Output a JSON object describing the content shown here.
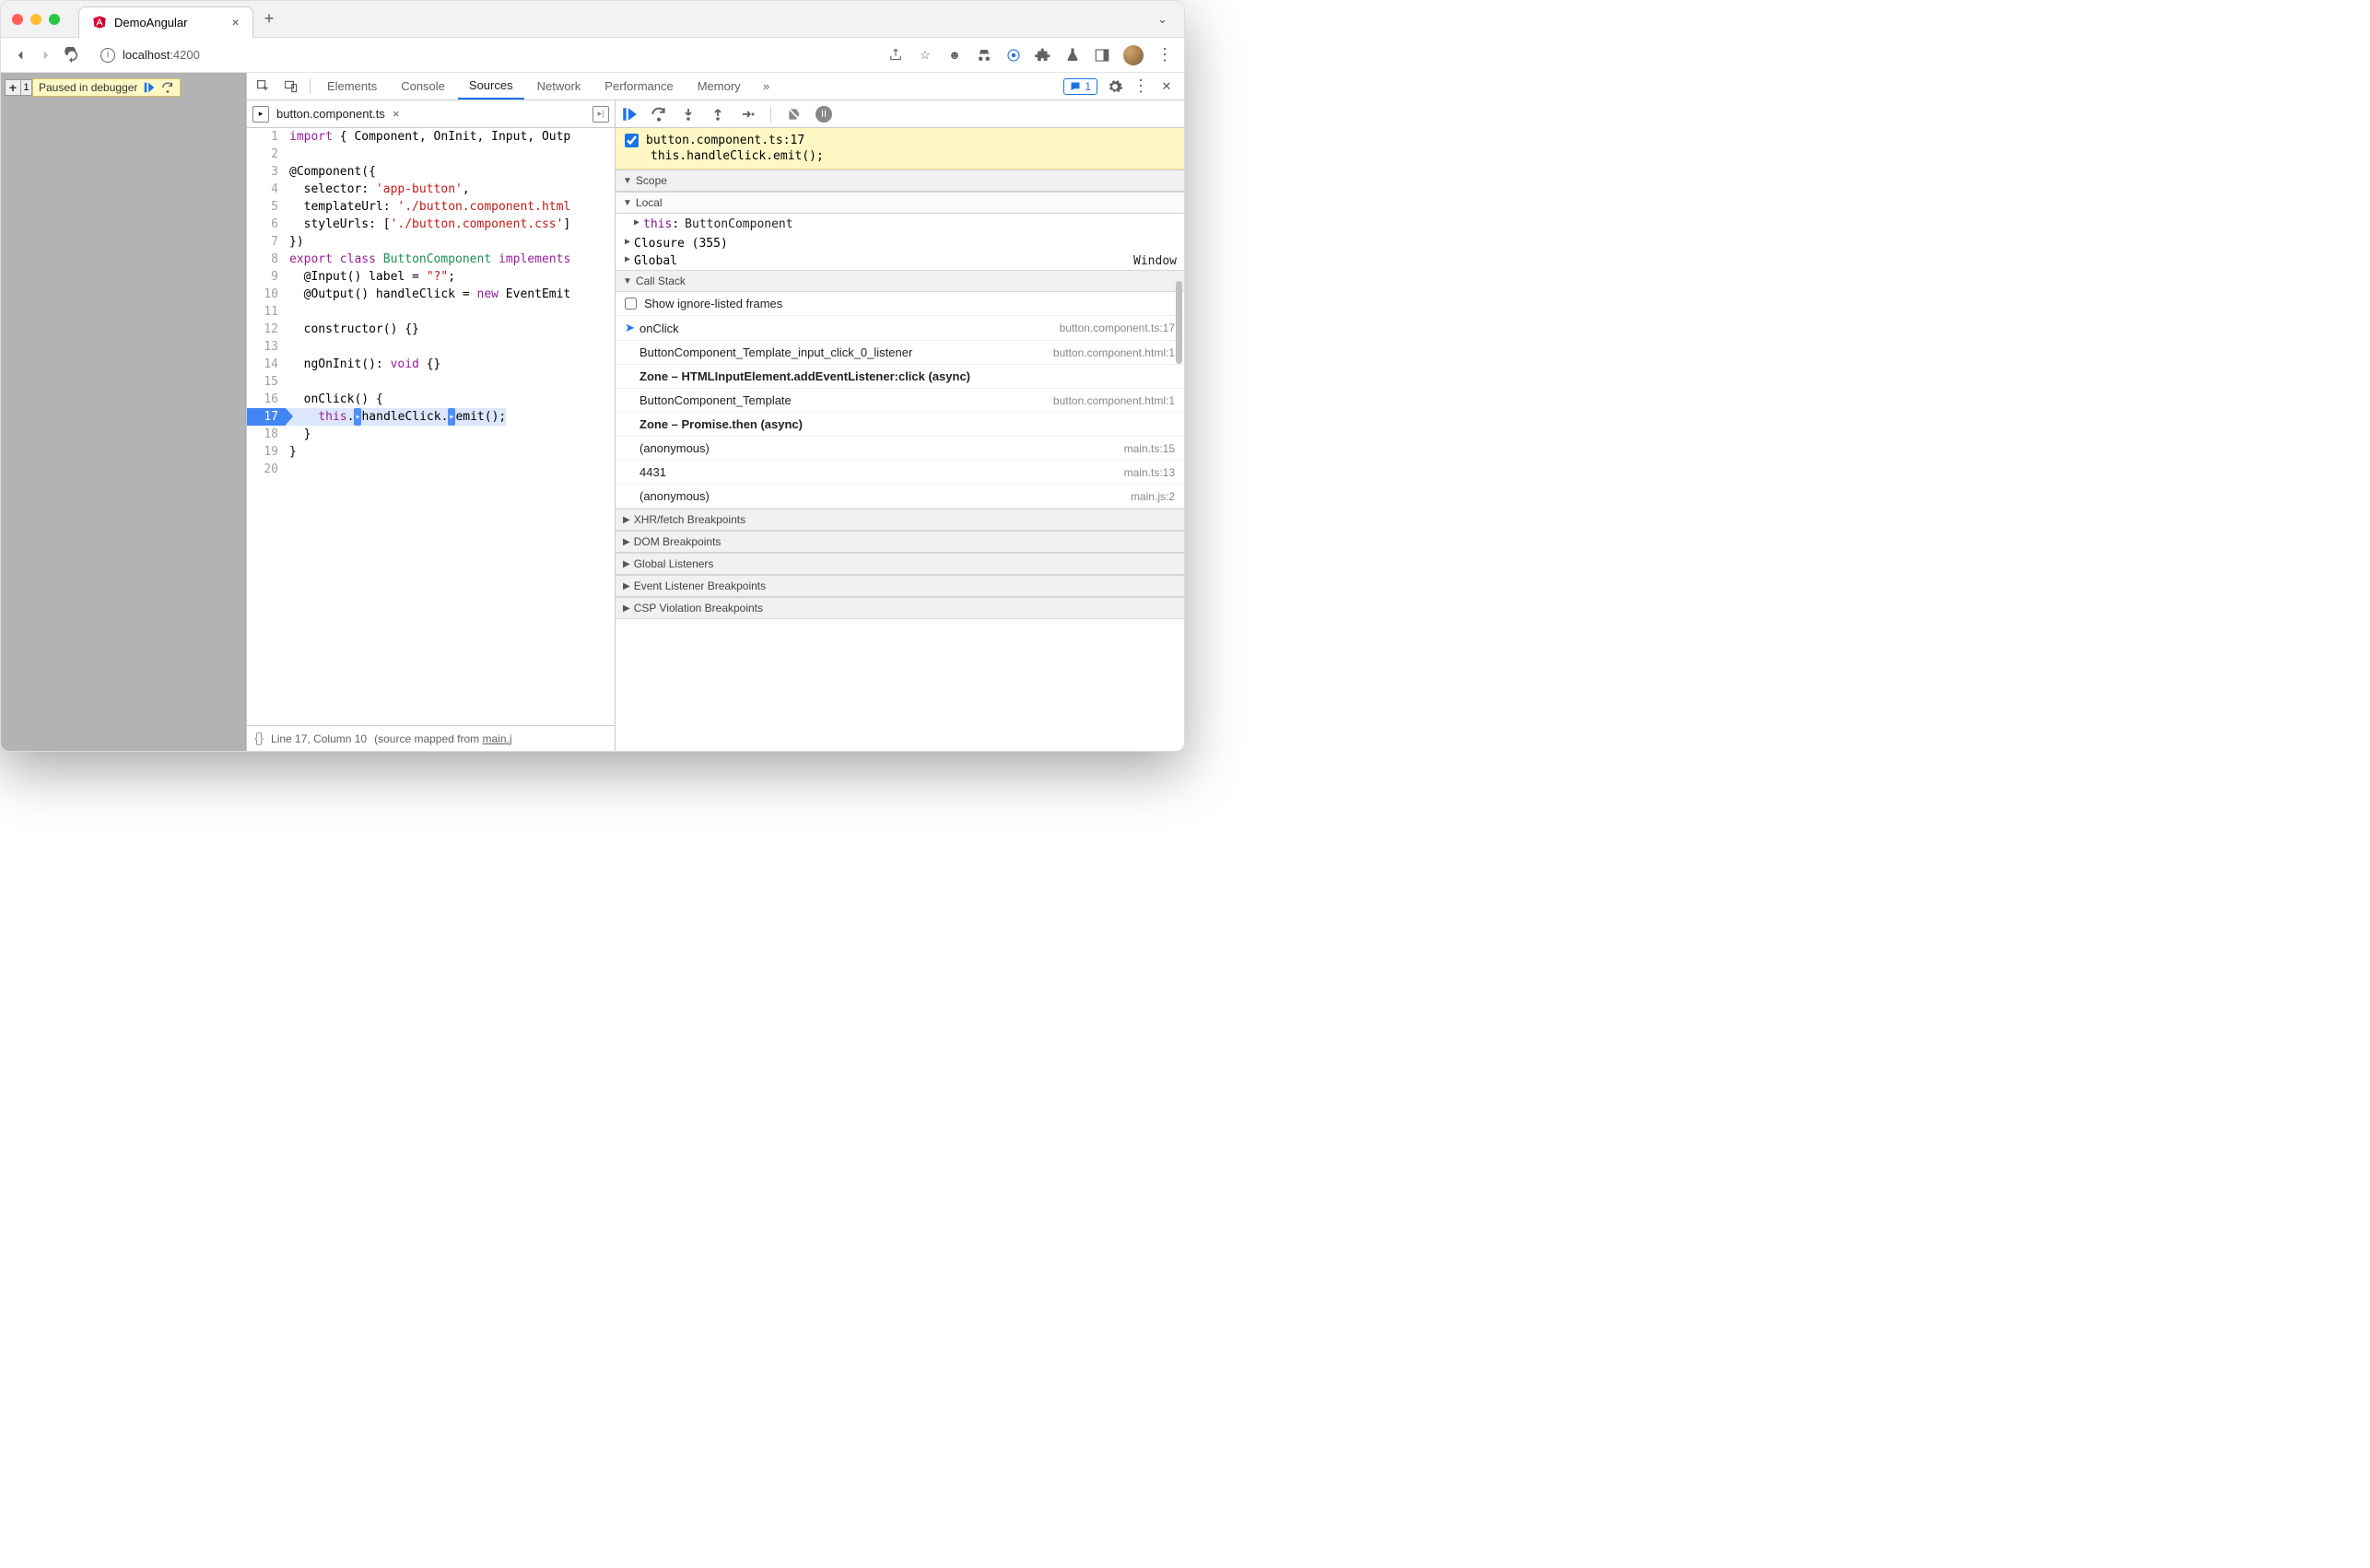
{
  "browser": {
    "tab_title": "DemoAngular",
    "url_host": "localhost",
    "url_path": ":4200"
  },
  "paused": {
    "label": "Paused in debugger"
  },
  "devtools": {
    "tabs": [
      "Elements",
      "Console",
      "Sources",
      "Network",
      "Performance",
      "Memory"
    ],
    "active_tab": "Sources",
    "issues_count": "1"
  },
  "editor": {
    "filename": "button.component.ts",
    "footer_line": "Line 17, Column 10",
    "footer_mapped": "(source mapped from ",
    "footer_mapped_file": "main.j",
    "lines": [
      {
        "n": 1,
        "html": "<span class='tok-kw'>import</span> { Component, OnInit, Input, Outp"
      },
      {
        "n": 2,
        "html": ""
      },
      {
        "n": 3,
        "html": "@Component({"
      },
      {
        "n": 4,
        "html": "  selector: <span class='tok-str'>'app-button'</span>,"
      },
      {
        "n": 5,
        "html": "  templateUrl: <span class='tok-str'>'./button.component.html</span>"
      },
      {
        "n": 6,
        "html": "  styleUrls: [<span class='tok-str'>'./button.component.css'</span>]"
      },
      {
        "n": 7,
        "html": "})"
      },
      {
        "n": 8,
        "html": "<span class='tok-kw'>export</span> <span class='tok-kw'>class</span> <span class='tok-cls'>ButtonComponent</span> <span class='tok-kw'>implements</span>"
      },
      {
        "n": 9,
        "html": "  @Input() label = <span class='tok-str'>\"?\"</span>;"
      },
      {
        "n": 10,
        "html": "  @Output() handleClick = <span class='tok-kw'>new</span> EventEmit"
      },
      {
        "n": 11,
        "html": ""
      },
      {
        "n": 12,
        "html": "  constructor() {}"
      },
      {
        "n": 13,
        "html": ""
      },
      {
        "n": 14,
        "html": "  ngOnInit(): <span class='tok-kw'>void</span> {}"
      },
      {
        "n": 15,
        "html": ""
      },
      {
        "n": 16,
        "html": "  onClick() {"
      },
      {
        "n": 17,
        "html": "    <span class='tok-kw'>this</span>.<span class='inline-bp'>▸</span>handleClick.<span class='inline-bp'>▸</span>emit();",
        "hl": true,
        "bp": true
      },
      {
        "n": 18,
        "html": "  }"
      },
      {
        "n": 19,
        "html": "}"
      },
      {
        "n": 20,
        "html": ""
      }
    ]
  },
  "breakpoint": {
    "file_loc": "button.component.ts:17",
    "code": "this.handleClick.emit();"
  },
  "scope": {
    "header": "Scope",
    "local": "Local",
    "this_label": "this",
    "this_value": "ButtonComponent",
    "closure": "Closure (355)",
    "global": "Global",
    "window": "Window"
  },
  "callstack": {
    "header": "Call Stack",
    "show_ignored": "Show ignore-listed frames",
    "frames": [
      {
        "name": "onClick",
        "loc": "button.component.ts:17",
        "current": true
      },
      {
        "name": "ButtonComponent_Template_input_click_0_listener",
        "loc": "button.component.html:1"
      },
      {
        "name": "Zone – HTMLInputElement.addEventListener:click (async)",
        "zone": true
      },
      {
        "name": "ButtonComponent_Template",
        "loc": "button.component.html:1"
      },
      {
        "name": "Zone – Promise.then (async)",
        "zone": true
      },
      {
        "name": "(anonymous)",
        "loc": "main.ts:15"
      },
      {
        "name": "4431",
        "loc": "main.ts:13"
      },
      {
        "name": "(anonymous)",
        "loc": "main.js:2"
      }
    ]
  },
  "panels": {
    "xhr": "XHR/fetch Breakpoints",
    "dom": "DOM Breakpoints",
    "glob": "Global Listeners",
    "evt": "Event Listener Breakpoints",
    "csp": "CSP Violation Breakpoints"
  }
}
